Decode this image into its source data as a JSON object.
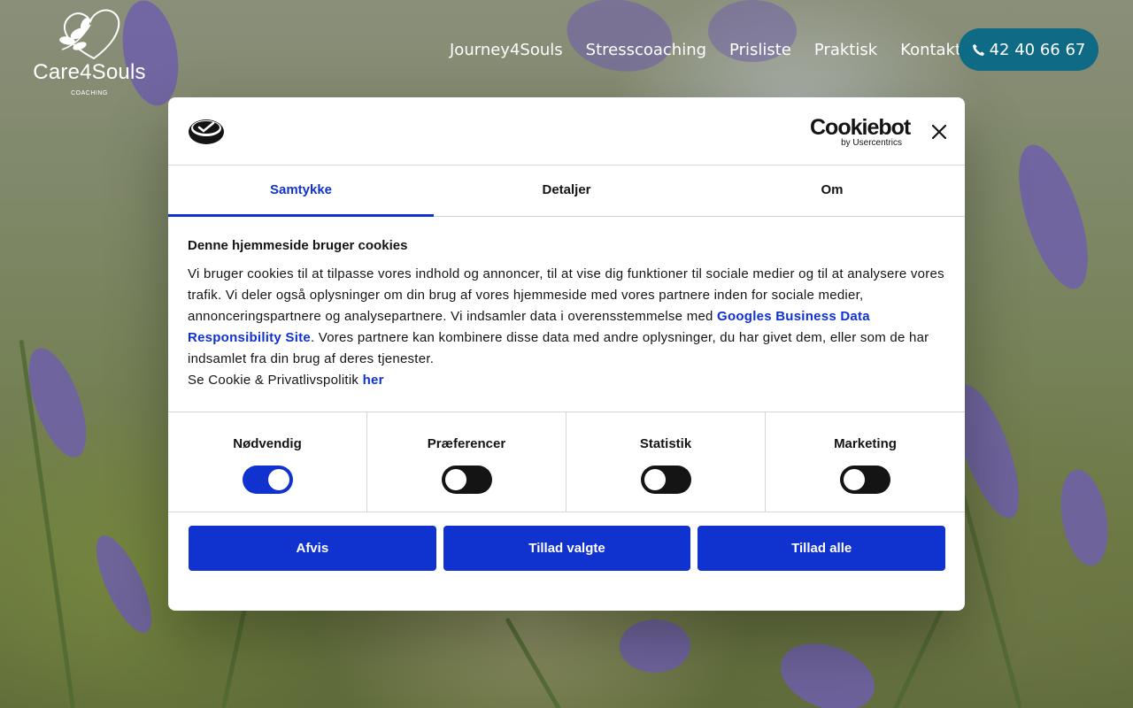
{
  "header": {
    "logo_name": "Care4Souls",
    "logo_tagline": "COACHING",
    "nav": [
      {
        "label": "Journey4Souls"
      },
      {
        "label": "Stresscoaching"
      },
      {
        "label": "Prisliste"
      },
      {
        "label": "Praktisk"
      },
      {
        "label": "Kontakt"
      }
    ],
    "phone": "42 40 66 67"
  },
  "cookie_dialog": {
    "brand_name": "Cookiebot",
    "brand_sub": "by Usercentrics",
    "tabs": [
      {
        "label": "Samtykke",
        "active": true
      },
      {
        "label": "Detaljer",
        "active": false
      },
      {
        "label": "Om",
        "active": false
      }
    ],
    "heading": "Denne hjemmeside bruger cookies",
    "text_1": "Vi bruger cookies til at tilpasse vores indhold og annoncer, til at vise dig funktioner til sociale medier og til at analysere vores trafik. Vi deler også oplysninger om din brug af vores hjemmeside med vores partnere inden for sociale medier, annonceringspartnere og analysepartnere. Vi indsamler data i overensstemmelse med ",
    "link_1": "Googles Business Data Responsibility Site",
    "text_2": ". Vores partnere kan kombinere disse data med andre oplysninger, du har givet dem, eller som de har indsamlet fra din brug af deres tjenester.",
    "policy_text": "Se Cookie & Privatlivspolitik ",
    "policy_link": "her",
    "toggles": [
      {
        "label": "Nødvendig",
        "on": true
      },
      {
        "label": "Præferencer",
        "on": false
      },
      {
        "label": "Statistik",
        "on": false
      },
      {
        "label": "Marketing",
        "on": false
      }
    ],
    "buttons": {
      "reject": "Afvis",
      "allow_selected": "Tillad valgte",
      "allow_all": "Tillad alle"
    }
  },
  "colors": {
    "accent": "#1032cf",
    "phone_button": "#0f6a86",
    "toggle_off": "#141414"
  }
}
